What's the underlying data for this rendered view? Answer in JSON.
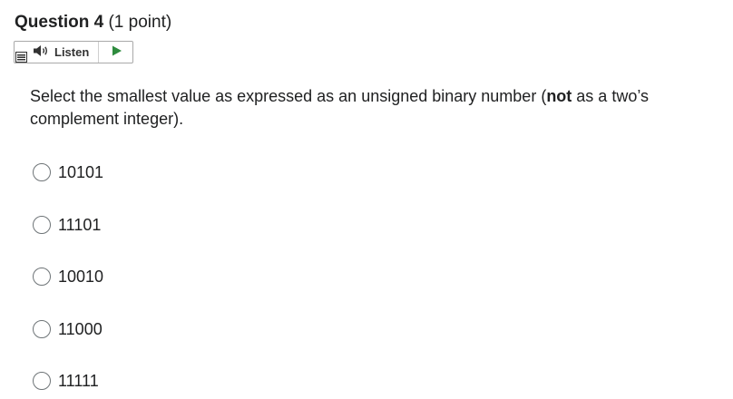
{
  "question": {
    "title": "Question 4",
    "points": "(1 point)"
  },
  "listen": {
    "label": "Listen"
  },
  "prompt": {
    "text_before": "Select the smallest value as expressed as an unsigned binary number (",
    "bold": "not",
    "text_after": " as a two’s complement integer)."
  },
  "options": [
    {
      "label": "10101",
      "selected": false
    },
    {
      "label": "11101",
      "selected": false
    },
    {
      "label": "10010",
      "selected": false
    },
    {
      "label": "11000",
      "selected": false
    },
    {
      "label": "11111",
      "selected": false
    }
  ],
  "colors": {
    "play_icon": "#2e8b3e",
    "text": "#202122",
    "radio_border": "#6e7477"
  }
}
